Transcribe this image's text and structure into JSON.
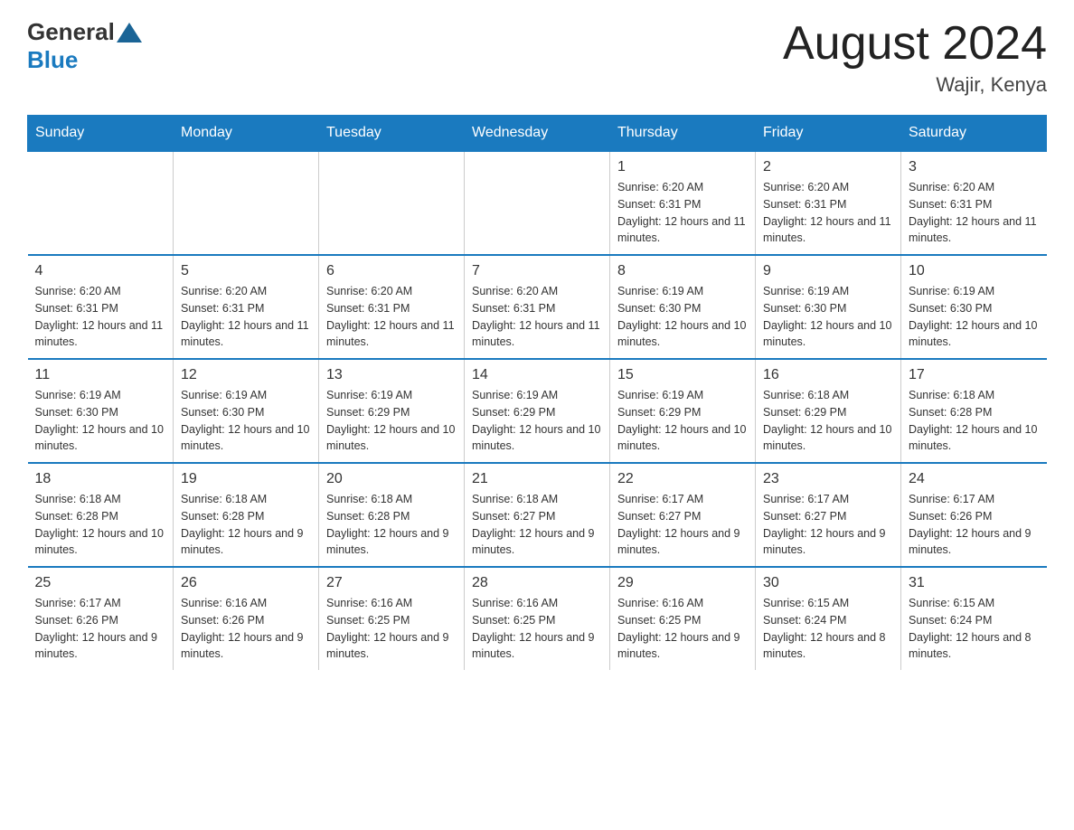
{
  "header": {
    "logo_general": "General",
    "logo_blue": "Blue",
    "month_title": "August 2024",
    "location": "Wajir, Kenya"
  },
  "days_of_week": [
    "Sunday",
    "Monday",
    "Tuesday",
    "Wednesday",
    "Thursday",
    "Friday",
    "Saturday"
  ],
  "weeks": [
    [
      {
        "day": "",
        "info": ""
      },
      {
        "day": "",
        "info": ""
      },
      {
        "day": "",
        "info": ""
      },
      {
        "day": "",
        "info": ""
      },
      {
        "day": "1",
        "info": "Sunrise: 6:20 AM\nSunset: 6:31 PM\nDaylight: 12 hours and 11 minutes."
      },
      {
        "day": "2",
        "info": "Sunrise: 6:20 AM\nSunset: 6:31 PM\nDaylight: 12 hours and 11 minutes."
      },
      {
        "day": "3",
        "info": "Sunrise: 6:20 AM\nSunset: 6:31 PM\nDaylight: 12 hours and 11 minutes."
      }
    ],
    [
      {
        "day": "4",
        "info": "Sunrise: 6:20 AM\nSunset: 6:31 PM\nDaylight: 12 hours and 11 minutes."
      },
      {
        "day": "5",
        "info": "Sunrise: 6:20 AM\nSunset: 6:31 PM\nDaylight: 12 hours and 11 minutes."
      },
      {
        "day": "6",
        "info": "Sunrise: 6:20 AM\nSunset: 6:31 PM\nDaylight: 12 hours and 11 minutes."
      },
      {
        "day": "7",
        "info": "Sunrise: 6:20 AM\nSunset: 6:31 PM\nDaylight: 12 hours and 11 minutes."
      },
      {
        "day": "8",
        "info": "Sunrise: 6:19 AM\nSunset: 6:30 PM\nDaylight: 12 hours and 10 minutes."
      },
      {
        "day": "9",
        "info": "Sunrise: 6:19 AM\nSunset: 6:30 PM\nDaylight: 12 hours and 10 minutes."
      },
      {
        "day": "10",
        "info": "Sunrise: 6:19 AM\nSunset: 6:30 PM\nDaylight: 12 hours and 10 minutes."
      }
    ],
    [
      {
        "day": "11",
        "info": "Sunrise: 6:19 AM\nSunset: 6:30 PM\nDaylight: 12 hours and 10 minutes."
      },
      {
        "day": "12",
        "info": "Sunrise: 6:19 AM\nSunset: 6:30 PM\nDaylight: 12 hours and 10 minutes."
      },
      {
        "day": "13",
        "info": "Sunrise: 6:19 AM\nSunset: 6:29 PM\nDaylight: 12 hours and 10 minutes."
      },
      {
        "day": "14",
        "info": "Sunrise: 6:19 AM\nSunset: 6:29 PM\nDaylight: 12 hours and 10 minutes."
      },
      {
        "day": "15",
        "info": "Sunrise: 6:19 AM\nSunset: 6:29 PM\nDaylight: 12 hours and 10 minutes."
      },
      {
        "day": "16",
        "info": "Sunrise: 6:18 AM\nSunset: 6:29 PM\nDaylight: 12 hours and 10 minutes."
      },
      {
        "day": "17",
        "info": "Sunrise: 6:18 AM\nSunset: 6:28 PM\nDaylight: 12 hours and 10 minutes."
      }
    ],
    [
      {
        "day": "18",
        "info": "Sunrise: 6:18 AM\nSunset: 6:28 PM\nDaylight: 12 hours and 10 minutes."
      },
      {
        "day": "19",
        "info": "Sunrise: 6:18 AM\nSunset: 6:28 PM\nDaylight: 12 hours and 9 minutes."
      },
      {
        "day": "20",
        "info": "Sunrise: 6:18 AM\nSunset: 6:28 PM\nDaylight: 12 hours and 9 minutes."
      },
      {
        "day": "21",
        "info": "Sunrise: 6:18 AM\nSunset: 6:27 PM\nDaylight: 12 hours and 9 minutes."
      },
      {
        "day": "22",
        "info": "Sunrise: 6:17 AM\nSunset: 6:27 PM\nDaylight: 12 hours and 9 minutes."
      },
      {
        "day": "23",
        "info": "Sunrise: 6:17 AM\nSunset: 6:27 PM\nDaylight: 12 hours and 9 minutes."
      },
      {
        "day": "24",
        "info": "Sunrise: 6:17 AM\nSunset: 6:26 PM\nDaylight: 12 hours and 9 minutes."
      }
    ],
    [
      {
        "day": "25",
        "info": "Sunrise: 6:17 AM\nSunset: 6:26 PM\nDaylight: 12 hours and 9 minutes."
      },
      {
        "day": "26",
        "info": "Sunrise: 6:16 AM\nSunset: 6:26 PM\nDaylight: 12 hours and 9 minutes."
      },
      {
        "day": "27",
        "info": "Sunrise: 6:16 AM\nSunset: 6:25 PM\nDaylight: 12 hours and 9 minutes."
      },
      {
        "day": "28",
        "info": "Sunrise: 6:16 AM\nSunset: 6:25 PM\nDaylight: 12 hours and 9 minutes."
      },
      {
        "day": "29",
        "info": "Sunrise: 6:16 AM\nSunset: 6:25 PM\nDaylight: 12 hours and 9 minutes."
      },
      {
        "day": "30",
        "info": "Sunrise: 6:15 AM\nSunset: 6:24 PM\nDaylight: 12 hours and 8 minutes."
      },
      {
        "day": "31",
        "info": "Sunrise: 6:15 AM\nSunset: 6:24 PM\nDaylight: 12 hours and 8 minutes."
      }
    ]
  ]
}
